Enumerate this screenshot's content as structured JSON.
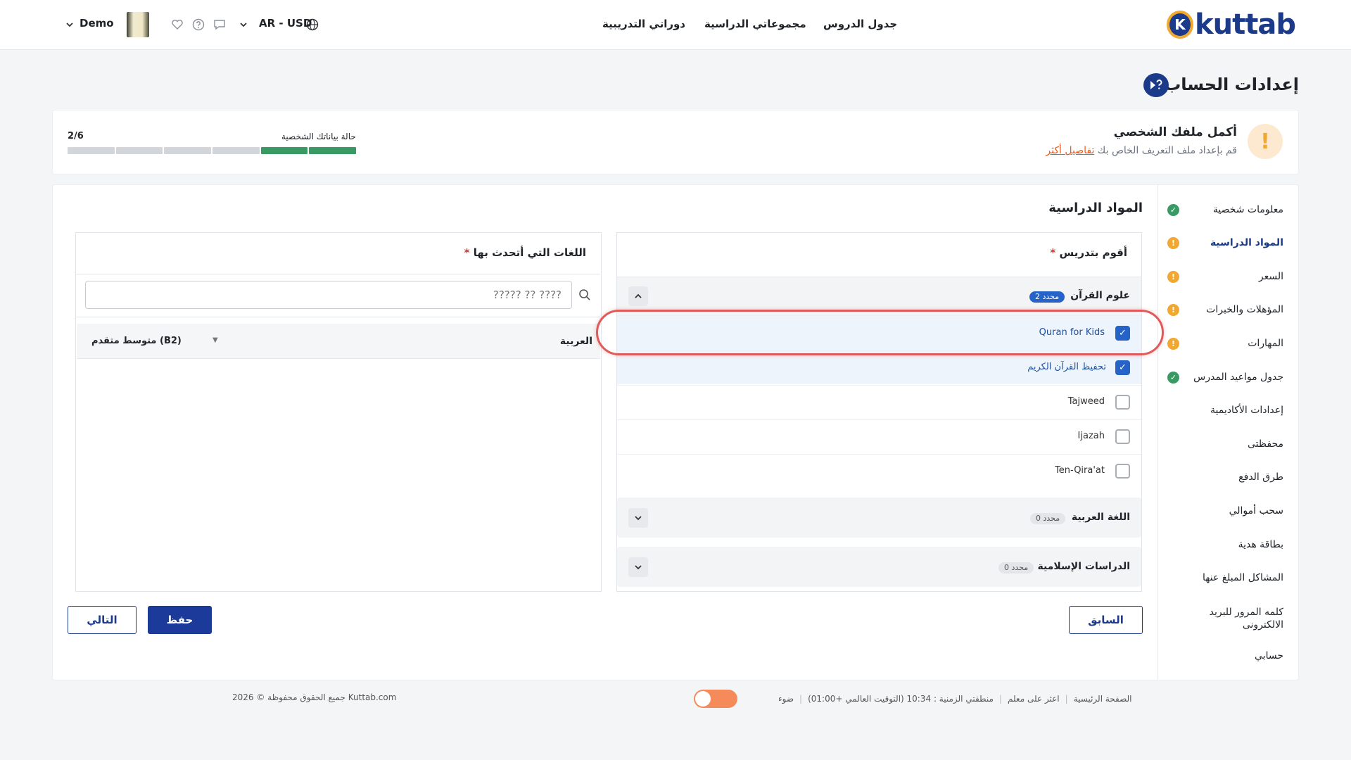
{
  "header": {
    "logo_text": "kuttab",
    "logo_letter": "K",
    "nav": [
      "جدول الدروس",
      "مجموعاتي الدراسية",
      "دوراتي التدريبية"
    ],
    "locale": "AR - USD",
    "user_name": "Demo"
  },
  "page_title": "إعدادات الحساب",
  "profile": {
    "title": "أكمل ملفك الشخصي",
    "subtitle": "قم بإعداد ملف التعريف الخاص بك",
    "details_link": "تفاصيل أكثر",
    "progress_label": "حالة بياناتك الشخصية",
    "progress_count": "2/6",
    "progress_fraction": 0.333
  },
  "sidebar": {
    "items": [
      {
        "label": "معلومات شخصية",
        "status": "ok"
      },
      {
        "label": "المواد الدراسية",
        "status": "warn",
        "active": true
      },
      {
        "label": "السعر",
        "status": "warn"
      },
      {
        "label": "المؤهلات والخبرات",
        "status": "warn"
      },
      {
        "label": "المهارات",
        "status": "warn"
      },
      {
        "label": "جدول مواعيد المدرس",
        "status": "ok"
      },
      {
        "label": "إعدادات الأكاديمية"
      },
      {
        "label": "محفظتى"
      },
      {
        "label": "طرق الدفع"
      },
      {
        "label": "سحب أموالي"
      },
      {
        "label": "بطاقة هدية"
      },
      {
        "label": "المشاكل المبلغ عنها"
      },
      {
        "label": "كلمه المرور للبريد الالكترونى"
      },
      {
        "label": "حسابي"
      }
    ]
  },
  "main": {
    "section_title": "المواد الدراسية",
    "teach_label": "أقوم بتدريس",
    "required_mark": "*",
    "groups": [
      {
        "name": "علوم القرآن",
        "badge": "2 محدد",
        "expanded": true,
        "options": [
          {
            "label": "Quran for Kids",
            "checked": true
          },
          {
            "label": "تحفيظ القرآن الكريم",
            "checked": true
          },
          {
            "label": "Tajweed",
            "checked": false
          },
          {
            "label": "Ijazah",
            "checked": false
          },
          {
            "label": "Ten-Qira'at",
            "checked": false
          }
        ]
      },
      {
        "name": "اللغة العربية",
        "badge": "0 محدد",
        "expanded": false
      },
      {
        "name": "الدراسات الإسلامية",
        "badge": "0 محدد",
        "expanded": false
      }
    ],
    "languages_label": "اللغات التي أتحدث بها",
    "search_placeholder": "????? ?? ????",
    "languages": [
      {
        "name": "العربية",
        "level": "متوسط متقدم (B2)"
      }
    ],
    "buttons": {
      "previous": "السابق",
      "save": "حفظ",
      "next": "التالي"
    }
  },
  "footer": {
    "home": "الصفحة الرئيسية",
    "find_teacher": "اعثر على معلم",
    "timezone": "منطقتي الزمنية : 10:34 (التوقيت العالمي +01:00)",
    "theme_label": "ضوء",
    "copyright": "جميع الحقوق محفوظة © 2026 Kuttab.com"
  },
  "colors": {
    "brand": "#1b3a8a",
    "accent": "#f0a830",
    "success": "#3a9a64",
    "checkbox": "#2563c9",
    "highlight": "#e05a5a"
  }
}
